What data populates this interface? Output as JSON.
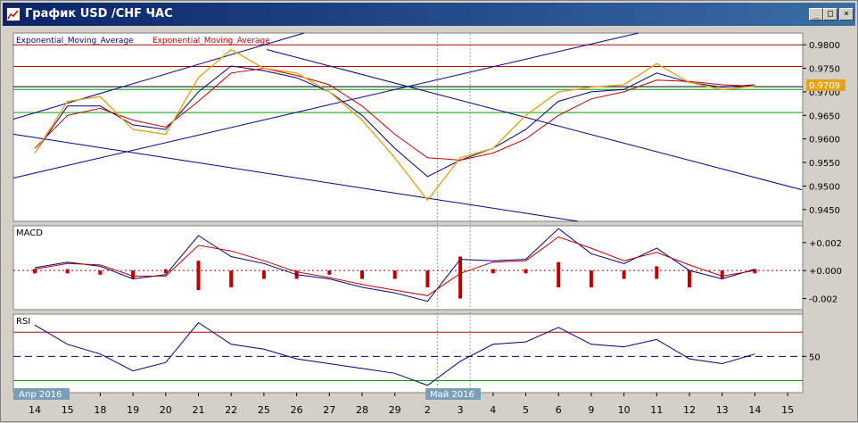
{
  "window": {
    "title": "График USD /CHF ЧАС",
    "buttons": [
      "_",
      "□",
      "×"
    ]
  },
  "indicators": {
    "ema_label_1": "Exponential_Moving_Average",
    "ema_label_2": "Exponential_Moving_Average",
    "macd_label": "MACD",
    "rsi_label": "RSI"
  },
  "colors": {
    "price": "#e8a317",
    "ema_fast": "#000080",
    "ema_slow": "#c00000",
    "channel": "#00008b",
    "level_red": "#c00000",
    "level_green": "#00a000",
    "current_price_bg": "#e8a317"
  },
  "chart_data": [
    {
      "type": "line",
      "panel": "price",
      "ylim": [
        0.9425,
        0.9825
      ],
      "y_ticks": [
        "0.9800",
        "0.9750",
        "0.9700",
        "0.9650",
        "0.9600",
        "0.9550",
        "0.9500",
        "0.9450"
      ],
      "current_price": "0.9709",
      "levels": [
        {
          "value": 0.98,
          "color": "red"
        },
        {
          "value": 0.9754,
          "color": "red"
        },
        {
          "value": 0.9711,
          "color": "black"
        },
        {
          "value": 0.9705,
          "color": "green"
        },
        {
          "value": 0.9656,
          "color": "green"
        }
      ],
      "x_day_index": [
        0,
        1,
        2,
        3,
        4,
        5,
        6,
        7,
        8,
        9,
        10,
        11,
        12,
        13,
        14,
        15,
        16,
        17,
        18,
        19,
        20,
        21,
        22,
        23,
        24
      ],
      "series": [
        {
          "name": "Exponential_Moving_Average",
          "values": [
            0.957,
            0.967,
            0.967,
            0.963,
            0.962,
            0.97,
            0.9755,
            0.9745,
            0.973,
            0.97,
            0.965,
            0.958,
            0.952,
            0.9555,
            0.958,
            0.962,
            0.968,
            0.97,
            0.9705,
            0.974,
            0.972,
            0.971,
            0.9715,
            null,
            null
          ]
        },
        {
          "name": "Exponential_Moving_Average",
          "values": [
            0.958,
            0.965,
            0.9665,
            0.964,
            0.9625,
            0.968,
            0.974,
            0.975,
            0.9735,
            0.9715,
            0.967,
            0.961,
            0.956,
            0.9555,
            0.957,
            0.96,
            0.965,
            0.9685,
            0.97,
            0.9725,
            0.9722,
            0.9715,
            0.9712,
            null,
            null
          ]
        },
        {
          "values": [
            0.957,
            0.968,
            0.969,
            0.962,
            0.961,
            0.973,
            0.979,
            0.975,
            0.974,
            0.97,
            0.964,
            0.956,
            0.947,
            0.956,
            0.958,
            0.965,
            0.97,
            0.971,
            0.9715,
            0.976,
            0.972,
            0.9705,
            0.9712,
            null,
            null
          ]
        }
      ]
    },
    {
      "type": "line",
      "panel": "macd",
      "y_ticks": [
        "+0.002",
        "+0.000",
        "-0.002"
      ],
      "ylim": [
        -0.0028,
        0.0032
      ],
      "x_day_index": [
        0,
        1,
        2,
        3,
        4,
        5,
        6,
        7,
        8,
        9,
        10,
        11,
        12,
        13,
        14,
        15,
        16,
        17,
        18,
        19,
        20,
        21,
        22
      ],
      "series": [
        {
          "name": "MACD",
          "values": [
            0.0002,
            0.0006,
            0.0003,
            -0.0006,
            -0.0003,
            0.0025,
            0.001,
            0.0005,
            -0.0003,
            -0.0006,
            -0.0012,
            -0.0016,
            -0.0022,
            0.0008,
            0.0007,
            0.0008,
            0.003,
            0.0012,
            0.0005,
            0.0016,
            0.0,
            -0.0006,
            0.0001
          ]
        },
        {
          "values": [
            0.0001,
            0.0005,
            0.0004,
            -0.0004,
            -0.0004,
            0.0018,
            0.0014,
            0.0007,
            -0.0001,
            -0.0005,
            -0.001,
            -0.0014,
            -0.0018,
            -0.0002,
            0.0006,
            0.0007,
            0.0024,
            0.0016,
            0.0007,
            0.0013,
            0.0004,
            -0.0004,
            0.0
          ]
        }
      ]
    },
    {
      "type": "line",
      "panel": "rsi",
      "ylim": [
        20,
        85
      ],
      "y_ticks": [
        "50"
      ],
      "levels": [
        70,
        50,
        30
      ],
      "x_day_index": [
        0,
        1,
        2,
        3,
        4,
        5,
        6,
        7,
        8,
        9,
        10,
        11,
        12,
        13,
        14,
        15,
        16,
        17,
        18,
        19,
        20,
        21,
        22
      ],
      "series": [
        {
          "name": "RSI",
          "values": [
            76,
            60,
            52,
            38,
            45,
            78,
            60,
            56,
            48,
            44,
            40,
            36,
            26,
            46,
            60,
            62,
            74,
            60,
            58,
            64,
            48,
            44,
            52
          ]
        }
      ]
    }
  ],
  "x_axis": {
    "day_labels": [
      "14",
      "15",
      "18",
      "19",
      "20",
      "21",
      "22",
      "25",
      "26",
      "27",
      "28",
      "29",
      "2",
      "3",
      "4",
      "5",
      "6",
      "9",
      "10",
      "11",
      "12",
      "13",
      "14",
      "15"
    ],
    "month_labels": [
      "Апр 2016",
      "Май 2016"
    ]
  }
}
